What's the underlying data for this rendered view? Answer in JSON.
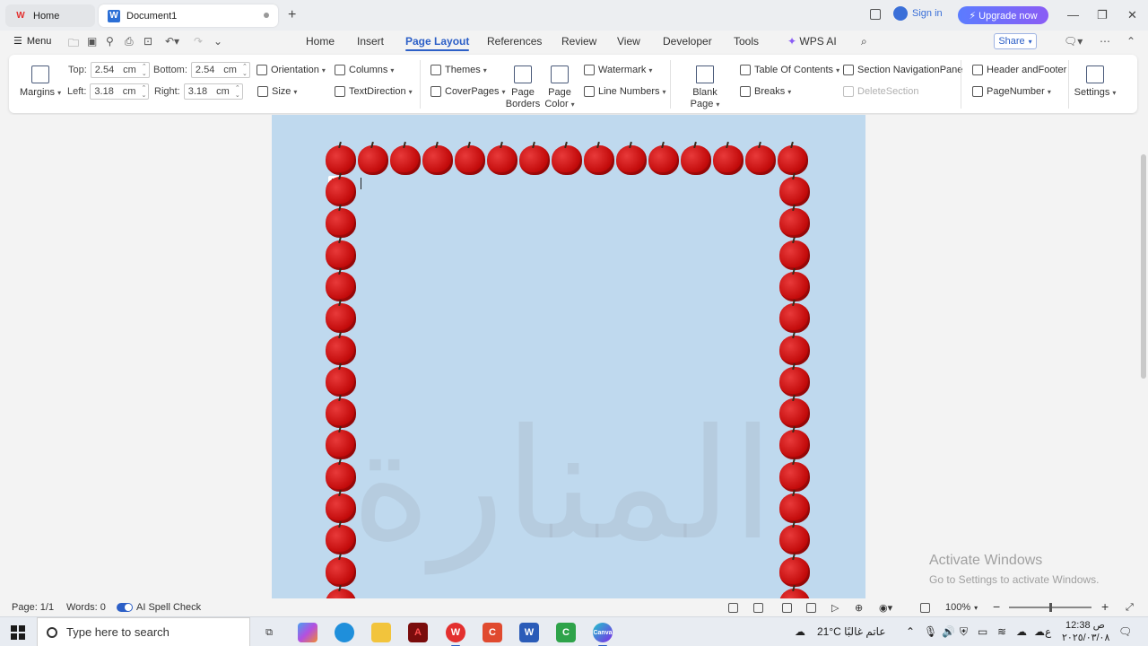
{
  "titlebar": {
    "tab_home": "Home",
    "tab_document": "Document1",
    "new_tab_symbol": "+",
    "sign_in": "Sign in",
    "upgrade": "⚡ Upgrade now",
    "minimize": "—",
    "restore": "❐",
    "close": "✕"
  },
  "menubar": {
    "menu_label": "Menu",
    "tabs": [
      "Home",
      "Insert",
      "Page Layout",
      "References",
      "Review",
      "View",
      "Developer",
      "Tools"
    ],
    "active_tab": "Page Layout",
    "wps_ai": "WPS AI",
    "share": "Share"
  },
  "ribbon": {
    "margins": "Margins",
    "top_label": "Top:",
    "top_value": "2.54",
    "top_unit": "cm",
    "bottom_label": "Bottom:",
    "bottom_value": "2.54",
    "bottom_unit": "cm",
    "left_label": "Left:",
    "left_value": "3.18",
    "left_unit": "cm",
    "right_label": "Right:",
    "right_value": "3.18",
    "right_unit": "cm",
    "orientation": "Orientation",
    "size": "Size",
    "columns": "Columns",
    "text_direction": "TextDirection",
    "themes": "Themes",
    "cover_pages": "CoverPages",
    "page_borders_1": "Page",
    "page_borders_2": "Borders",
    "page_color_1": "Page",
    "page_color_2": "Color",
    "watermark": "Watermark",
    "line_numbers": "Line Numbers",
    "blank_page": "Blank Page",
    "breaks": "Breaks",
    "table_of_contents": "Table Of Contents",
    "section_navigation": "Section NavigationPane",
    "delete_section": "DeleteSection",
    "header_footer": "Header andFooter",
    "page_number": "PageNumber",
    "settings": "Settings"
  },
  "document": {
    "watermark_text": "المنارة",
    "page_background": "#bfd9ee",
    "border_apple_color": "#d41414"
  },
  "activation": {
    "line1": "Activate Windows",
    "line2": "Go to Settings to activate Windows."
  },
  "statusbar": {
    "page": "Page: 1/1",
    "words": "Words: 0",
    "spell_check": "AI Spell Check",
    "zoom": "100%",
    "zoom_level": 0.5
  },
  "taskbar": {
    "search_placeholder": "Type here to search",
    "weather": "21°C عاتم غالبًا",
    "time": "12:38 ص",
    "date": "٢٠٢٥/٠٣/٠٨",
    "lang": "ع"
  }
}
